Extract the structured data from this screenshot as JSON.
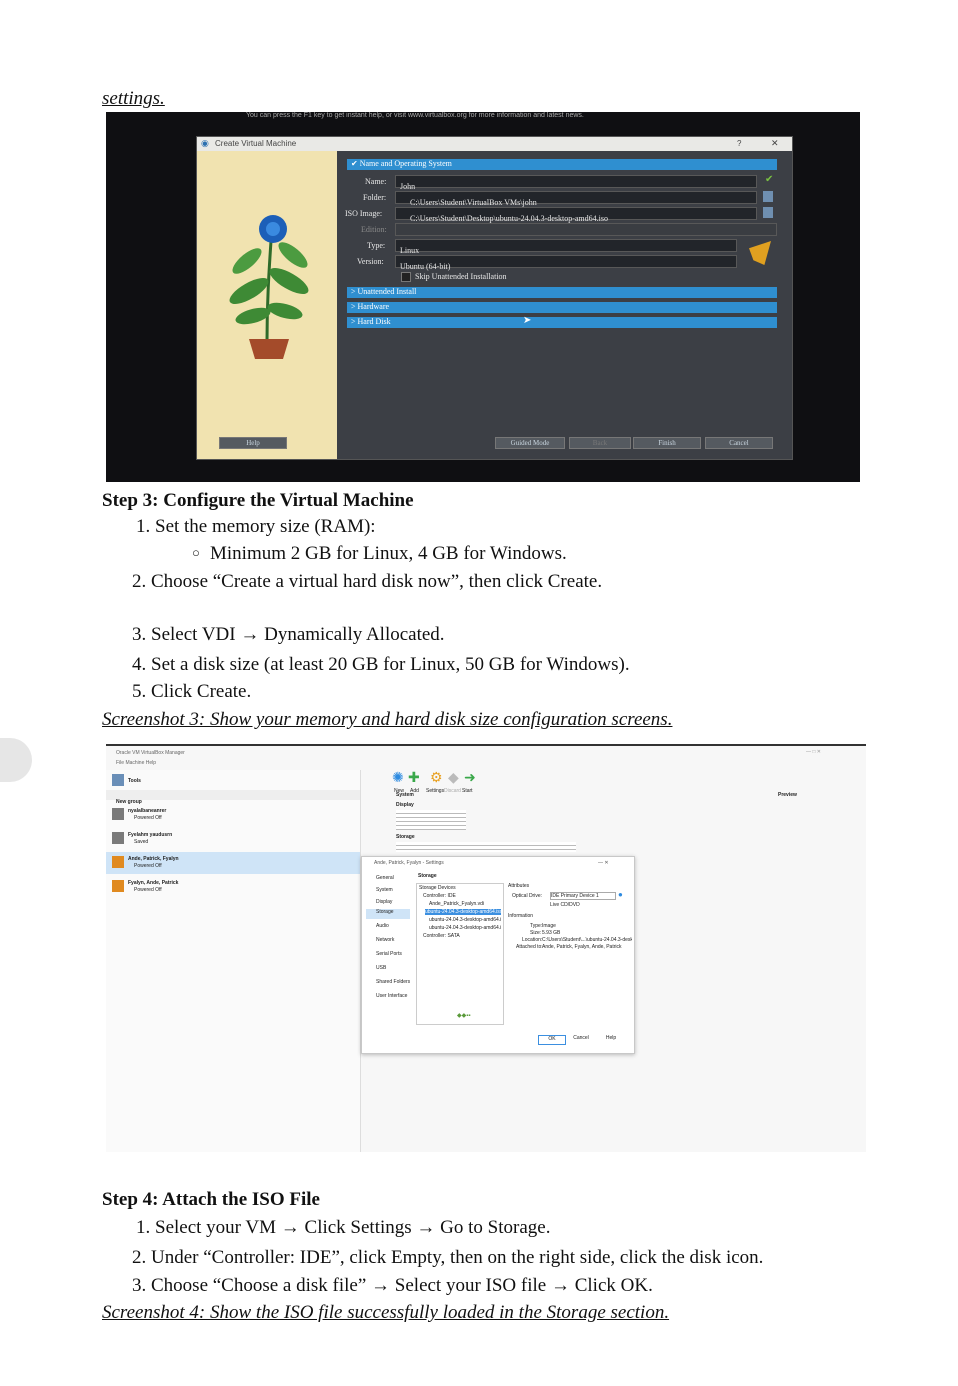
{
  "header": {
    "link": "settings."
  },
  "photo1": {
    "top_note": "You can press the F1 key to get instant help, or visit www.virtualbox.org for more information and latest news.",
    "title": "Create Virtual Machine",
    "section_name_os": "Name and Operating System",
    "name_label": "Name:",
    "name_value": "John",
    "folder_label": "Folder:",
    "folder_value": "C:\\Users\\Student\\VirtualBox VMs\\john",
    "iso_label": "ISO Image:",
    "iso_value": "C:\\Users\\Student\\Desktop\\ubuntu-24.04.3-desktop-amd64.iso",
    "edition_label": "Edition:",
    "type_label": "Type:",
    "type_value": "Linux",
    "version_label": "Version:",
    "version_value": "Ubuntu (64-bit)",
    "skip_label": "Skip Unattended Installation",
    "section_unattended": "Unattended Install",
    "section_hardware": "Hardware",
    "section_hard_disk": "Hard Disk",
    "help_btn": "Help",
    "guided_btn": "Guided Mode",
    "back_btn": "Back",
    "finish_btn": "Finish",
    "cancel_btn": "Cancel",
    "help_q": "?",
    "close_x": "✕"
  },
  "step3": {
    "heading": "Step 3: Configure the Virtual Machine",
    "item1": "1. Set the memory size (RAM):",
    "sub1": "Minimum 2 GB for Linux, 4 GB for Windows.",
    "item2": "2. Choose “Create a virtual hard disk now”, then click Create.",
    "item3": "3. Select VDI → Dynamically Allocated.",
    "item4": "4. Set a disk size (at least 20 GB for Linux, 50 GB for Windows).",
    "item5": "5. Click Create.",
    "caption": "Screenshot 3: Show your memory and hard disk size configuration screens."
  },
  "shot2": {
    "manager_title": "Oracle VM VirtualBox Manager",
    "menu": "File  Machine  Help",
    "tools": "Tools",
    "group": "New group",
    "vms": [
      {
        "name": "nyalalbaneanrer",
        "state": "Powered Off"
      },
      {
        "name": "Fyelahm yaudusrn",
        "state": "Saved"
      },
      {
        "name": "Ande, Patrick, Fyalyn",
        "state": "Powered Off"
      },
      {
        "name": "Fyalyn, Ande, Patrick",
        "state": "Powered Off"
      }
    ],
    "toolbar": [
      "New",
      "Add",
      "Settings",
      "Discard",
      "Start"
    ],
    "preview": "Preview",
    "general": "General",
    "system": "System",
    "display": "Display",
    "storage": "Storage",
    "settings_title": "Ande, Patrick, Fyalyn - Settings",
    "settings_nav": [
      "General",
      "System",
      "Display",
      "Storage",
      "Audio",
      "Network",
      "Serial Ports",
      "USB",
      "Shared Folders",
      "User Interface"
    ],
    "storage_header": "Storage",
    "storage_devices": "Storage Devices",
    "controller_ide": "Controller: IDE",
    "disk1": "Ande_Patrick_Fyalyn.vdi",
    "iso1": "ubuntu-24.04.3-desktop-amd64.iso",
    "iso2": "ubuntu-24.04.3-desktop-amd64.iso",
    "iso3": "ubuntu-24.04.3-desktop-amd64.iso",
    "controller_sata": "Controller: SATA",
    "attributes": "Attributes",
    "optical_drive": "Optical Drive:",
    "optical_value": "IDE Primary Device 1",
    "live_cd": "Live CD/DVD",
    "information": "Information",
    "type_label": "Type:",
    "type_value": "Image",
    "size_label": "Size:",
    "size_value": "5.93 GB",
    "location_label": "Location:",
    "location_value": "C:\\Users\\Student\\...\\ubuntu-24.04.3-desktop-amd64.iso",
    "attached_label": "Attached to:",
    "attached_value": "Ande, Patrick, Fyalyn, Ande, Patrick",
    "ok": "OK",
    "cancel": "Cancel",
    "help": "Help",
    "tools_right": "Preview"
  },
  "step4": {
    "heading": "Step 4: Attach the ISO File",
    "item1": "1. Select your VM → Click Settings → Go to Storage.",
    "item2": "2. Under “Controller: IDE”, click Empty, then on the right side, click the disk icon.",
    "item3": "3. Choose “Choose a disk file” → Select your ISO file → Click OK.",
    "caption": "Screenshot 4: Show the ISO file successfully loaded in the Storage section."
  },
  "colors": {
    "accent": "#2f8fd0",
    "selected": "#3b8fe0"
  }
}
